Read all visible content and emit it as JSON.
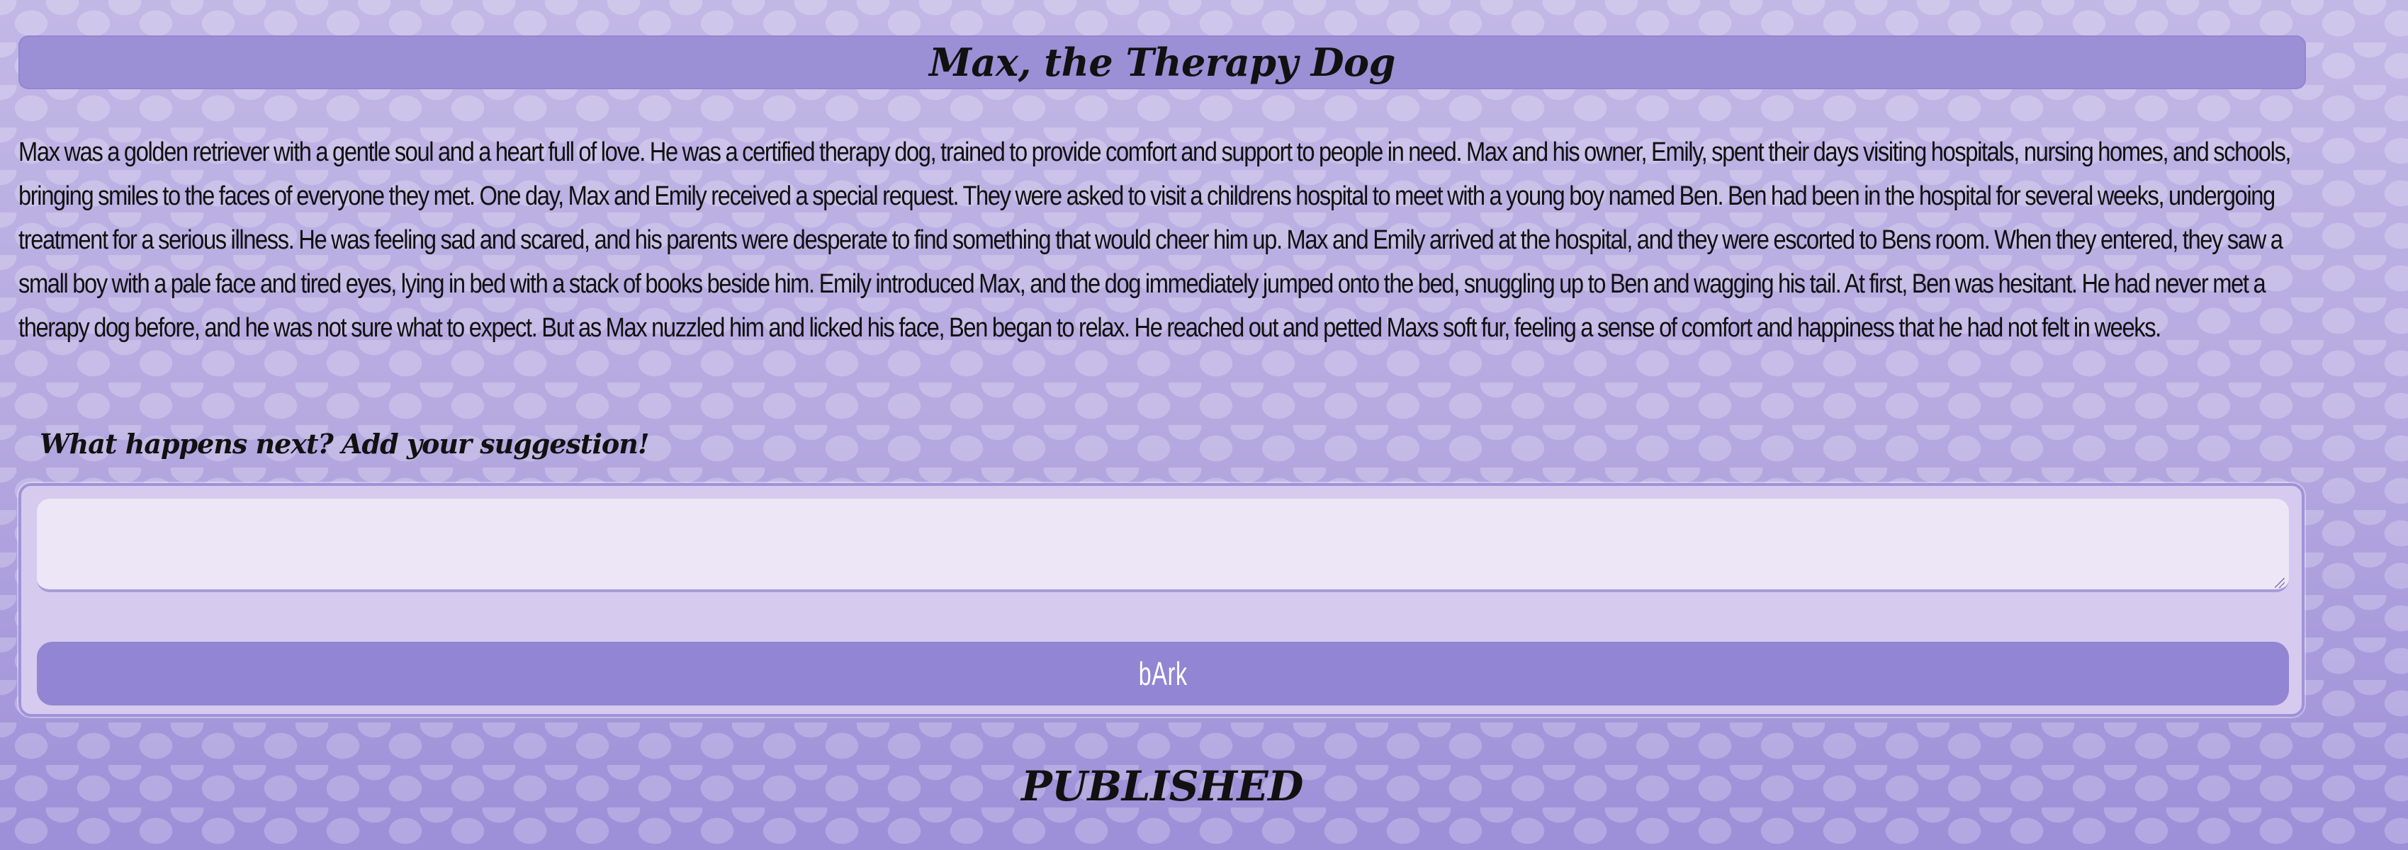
{
  "page": {
    "title": "Max, the Therapy Dog"
  },
  "story": {
    "text": "Max was a golden retriever with a gentle soul and a heart full of love. He was a certified therapy dog, trained to provide comfort and support to people in need. Max and his owner, Emily, spent their days visiting hospitals, nursing homes, and schools, bringing smiles to the faces of everyone they met. One day, Max and Emily received a special request. They were asked to visit a childrens hospital to meet with a young boy named Ben. Ben had been in the hospital for several weeks, undergoing treatment for a serious illness. He was feeling sad and scared, and his parents were desperate to find something that would cheer him up. Max and Emily arrived at the hospital, and they were escorted to Bens room. When they entered, they saw a small boy with a pale face and tired eyes, lying in bed with a stack of books beside him. Emily introduced Max, and the dog immediately jumped onto the bed, snuggling up to Ben and wagging his tail. At first, Ben was hesitant. He had never met a therapy dog before, and he was not sure what to expect. But as Max nuzzled him and licked his face, Ben began to relax. He reached out and petted Maxs soft fur, feeling a sense of comfort and happiness that he had not felt in weeks."
  },
  "suggestion_form": {
    "prompt_label": "What happens next? Add your suggestion!",
    "input_value": "",
    "input_placeholder": "",
    "submit_label": "bArk"
  },
  "status": {
    "label": "PUBLISHED"
  },
  "colors": {
    "background": "#b9aee0",
    "title_bar": "#9b8fd6",
    "panel": "#d6caee",
    "panel_border": "#9f93d8",
    "input": "#ece6f7",
    "button": "#9285d3",
    "button_text": "#ffffff",
    "text": "#111111"
  },
  "icons": {
    "textarea_resize": "resize-grip-icon"
  }
}
